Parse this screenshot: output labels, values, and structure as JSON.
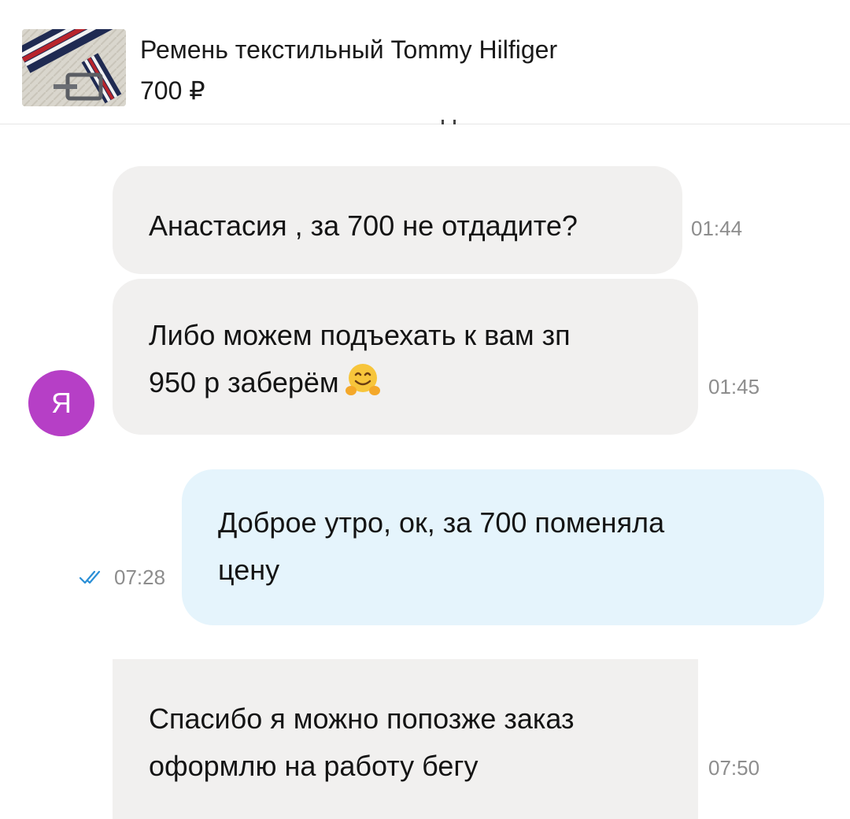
{
  "header": {
    "product_title": "Ремень текстильный Tommy Hilfiger",
    "product_price": "700 ₽"
  },
  "messages": [
    {
      "sender": "other",
      "lines": [
        "Анастасия , за 700 не отдадите?"
      ],
      "time": "01:44"
    },
    {
      "sender": "other",
      "lines": [
        "Либо можем подъехать к вам зп",
        "950 р заберём"
      ],
      "emoji": "hugging-face-icon",
      "time": "01:45"
    },
    {
      "sender": "me",
      "lines": [
        "Доброе утро, ок, за 700 поменяла",
        "цену"
      ],
      "time": "07:28",
      "status": "read-double-check-icon"
    },
    {
      "sender": "other",
      "lines": [
        "Спасибо я можно попозже заказ",
        "оформлю на работу бегу"
      ],
      "time": "07:50"
    }
  ],
  "avatar": {
    "letter": "Я",
    "color": "#b63fc6"
  },
  "colors": {
    "incoming_bubble": "#f1f0ef",
    "outgoing_bubble": "#e5f4fc",
    "timestamp": "#8d8d8d",
    "read_check": "#2a8fd6"
  }
}
